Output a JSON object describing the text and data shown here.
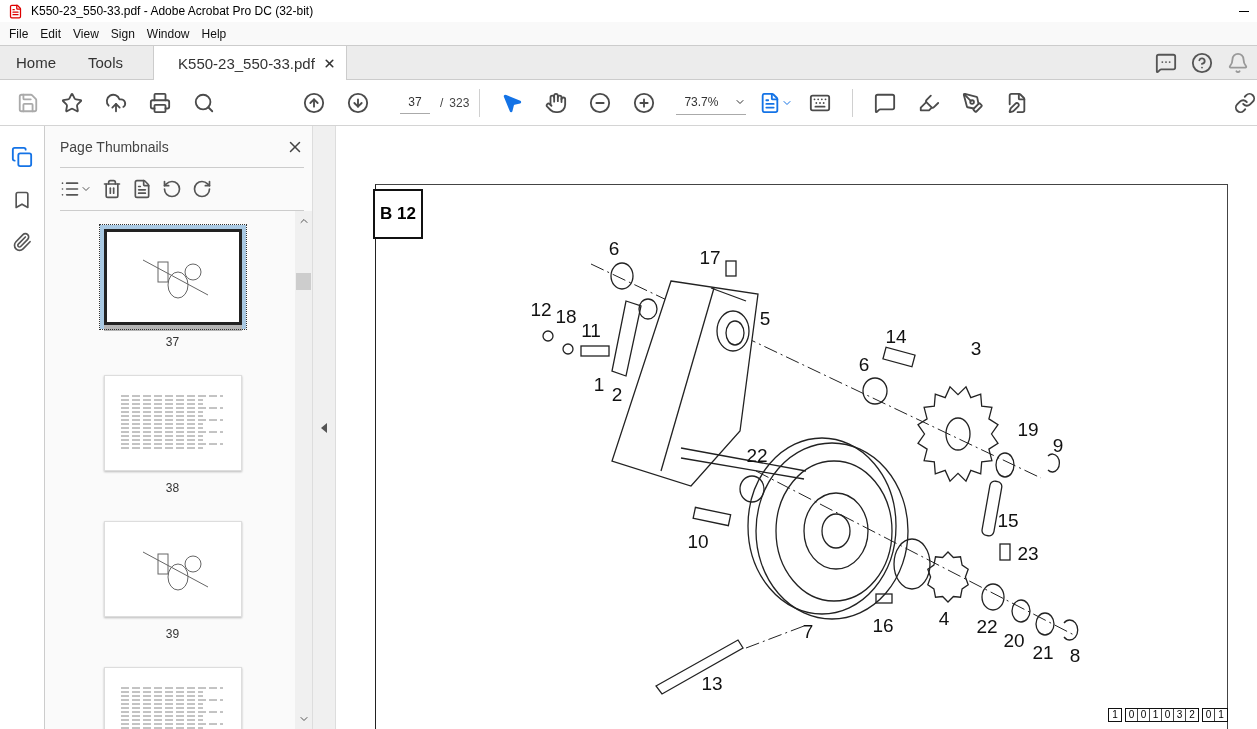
{
  "window": {
    "title": "K550-23_550-33.pdf - Adobe Acrobat Pro DC (32-bit)"
  },
  "menu": [
    "File",
    "Edit",
    "View",
    "Sign",
    "Window",
    "Help"
  ],
  "tabs": [
    {
      "label": "Home",
      "selected": false
    },
    {
      "label": "Tools",
      "selected": false
    },
    {
      "label": "K550-23_550-33.pdf",
      "selected": true
    }
  ],
  "toolbar": {
    "page_number": "37",
    "page_separator": "/",
    "page_total": "323",
    "zoom": "73.7%"
  },
  "side_rail": [
    {
      "kind": "pages",
      "selected": true
    },
    {
      "kind": "bookmarks",
      "selected": false
    },
    {
      "kind": "attachments",
      "selected": false
    }
  ],
  "panel": {
    "title": "Page Thumbnails",
    "thumbnails": [
      {
        "kind": "drawing",
        "label": "37",
        "selected": true
      },
      {
        "kind": "table",
        "label": "38",
        "selected": false
      },
      {
        "kind": "drawing",
        "label": "39",
        "selected": false
      },
      {
        "kind": "table",
        "selected": false
      }
    ]
  },
  "document": {
    "section": "B 12",
    "callouts": [
      "6",
      "17",
      "12",
      "18",
      "11",
      "5",
      "14",
      "3",
      "1",
      "2",
      "6",
      "19",
      "9",
      "22",
      "10",
      "15",
      "23",
      "16",
      "4",
      "22",
      "20",
      "21",
      "8",
      "7",
      "13"
    ],
    "code_groups": [
      [
        "1"
      ],
      [
        "0",
        "0",
        "1",
        "0",
        "3",
        "2"
      ],
      [
        "0",
        "1"
      ]
    ]
  }
}
